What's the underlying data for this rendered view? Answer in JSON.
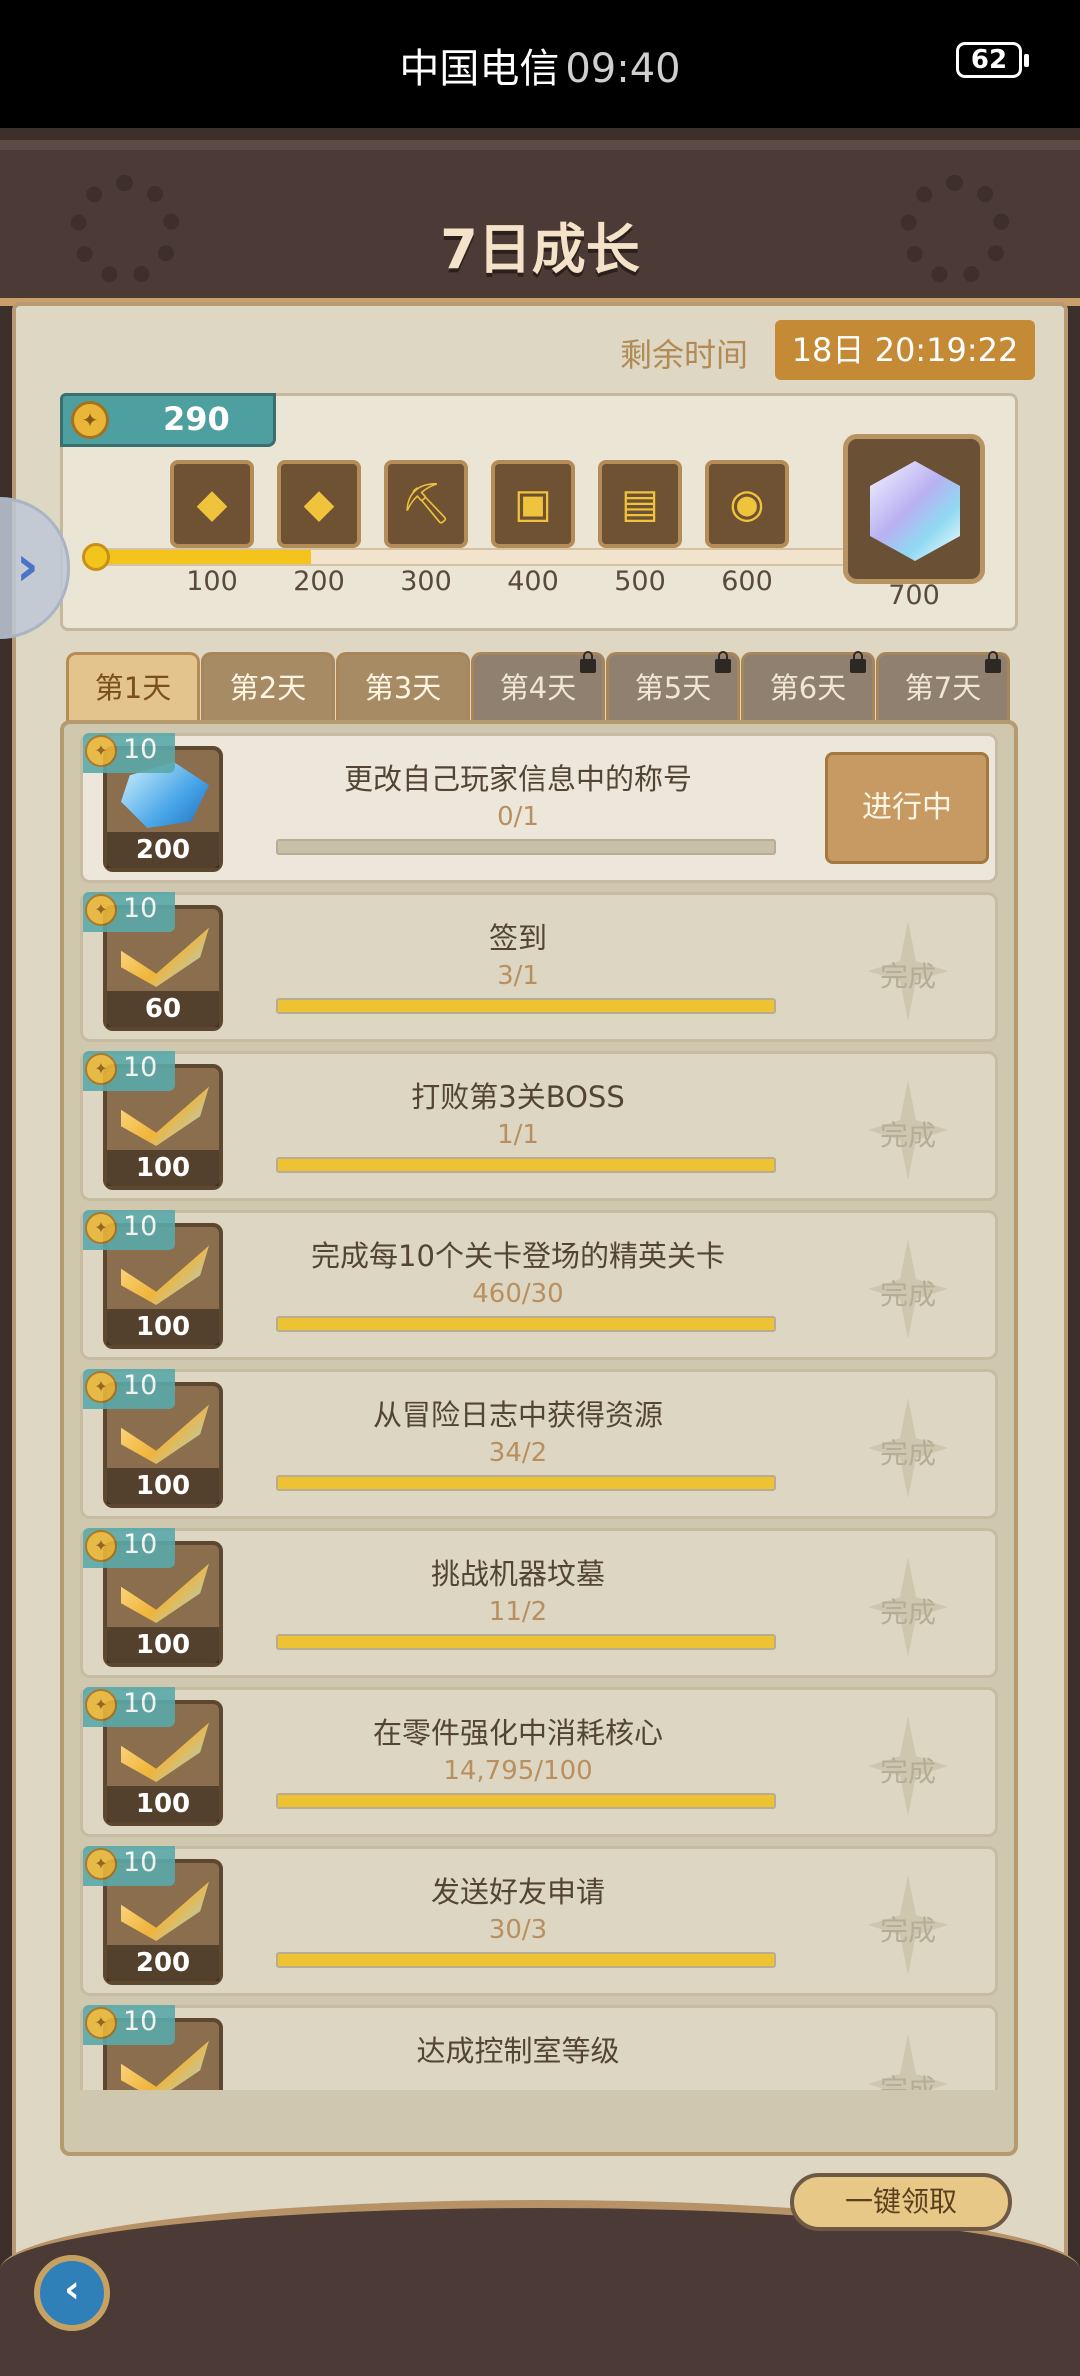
{
  "status_bar": {
    "carrier": "中国电信",
    "time": "09:40",
    "battery": "62"
  },
  "header": {
    "title": "7日成长"
  },
  "timer": {
    "label": "剩余时间",
    "value": "18日 20:19:22"
  },
  "points": {
    "value": "290",
    "progress_fraction": 0.28
  },
  "milestones": [
    {
      "label": "100",
      "icon": "gold-ticket-icon",
      "glyph": "◆"
    },
    {
      "label": "200",
      "icon": "gem-ticket-icon",
      "glyph": "◆"
    },
    {
      "label": "300",
      "icon": "pickaxe-icon",
      "glyph": "⛏"
    },
    {
      "label": "400",
      "icon": "gold-box-icon",
      "glyph": "▣"
    },
    {
      "label": "500",
      "icon": "card-pack-icon",
      "glyph": "▤"
    },
    {
      "label": "600",
      "icon": "egg-card-icon",
      "glyph": "◉"
    }
  ],
  "big_reward": {
    "label": "700",
    "icon": "crystal-icon"
  },
  "tabs": [
    {
      "label": "第1天",
      "state": "active"
    },
    {
      "label": "第2天",
      "state": "open"
    },
    {
      "label": "第3天",
      "state": "open"
    },
    {
      "label": "第4天",
      "state": "locked"
    },
    {
      "label": "第5天",
      "state": "locked"
    },
    {
      "label": "第6天",
      "state": "locked"
    },
    {
      "label": "第7天",
      "state": "locked"
    }
  ],
  "tasks": [
    {
      "points": "10",
      "reward_qty": "200",
      "reward_icon": "diamond-icon",
      "name": "更改自己玩家信息中的称号",
      "count": "0/1",
      "progress": 0,
      "status": "进行中"
    },
    {
      "points": "10",
      "reward_qty": "60",
      "reward_icon": "gold-ticket-icon",
      "name": "签到",
      "count": "3/1",
      "progress": 1,
      "status": "完成"
    },
    {
      "points": "10",
      "reward_qty": "100",
      "reward_icon": "gem-ticket-icon",
      "name": "打败第3关BOSS",
      "count": "1/1",
      "progress": 1,
      "status": "完成"
    },
    {
      "points": "10",
      "reward_qty": "100",
      "reward_icon": "gem-ticket-icon",
      "name": "完成每10个关卡登场的精英关卡",
      "count": "460/30",
      "progress": 1,
      "status": "完成"
    },
    {
      "points": "10",
      "reward_qty": "100",
      "reward_icon": "gem-ticket-icon",
      "name": "从冒险日志中获得资源",
      "count": "34/2",
      "progress": 1,
      "status": "完成"
    },
    {
      "points": "10",
      "reward_qty": "100",
      "reward_icon": "gem-ticket-icon",
      "name": "挑战机器坟墓",
      "count": "11/2",
      "progress": 1,
      "status": "完成"
    },
    {
      "points": "10",
      "reward_qty": "100",
      "reward_icon": "gem-ticket-icon",
      "name": "在零件强化中消耗核心",
      "count": "14,795/100",
      "progress": 1,
      "status": "完成"
    },
    {
      "points": "10",
      "reward_qty": "200",
      "reward_icon": "gem-ticket-icon",
      "name": "发送好友申请",
      "count": "30/3",
      "progress": 1,
      "status": "完成"
    },
    {
      "points": "10",
      "reward_qty": "",
      "reward_icon": "gem-ticket-icon",
      "name": "达成控制室等级",
      "count": "",
      "progress": 1,
      "status": "完成"
    }
  ],
  "footer": {
    "claim_all": "一键领取",
    "back_icon": "back-arrow-icon"
  },
  "colors": {
    "accent_gold": "#f3c51c",
    "timer_bg": "#c58a36",
    "teal_badge": "#4e9f9f"
  }
}
